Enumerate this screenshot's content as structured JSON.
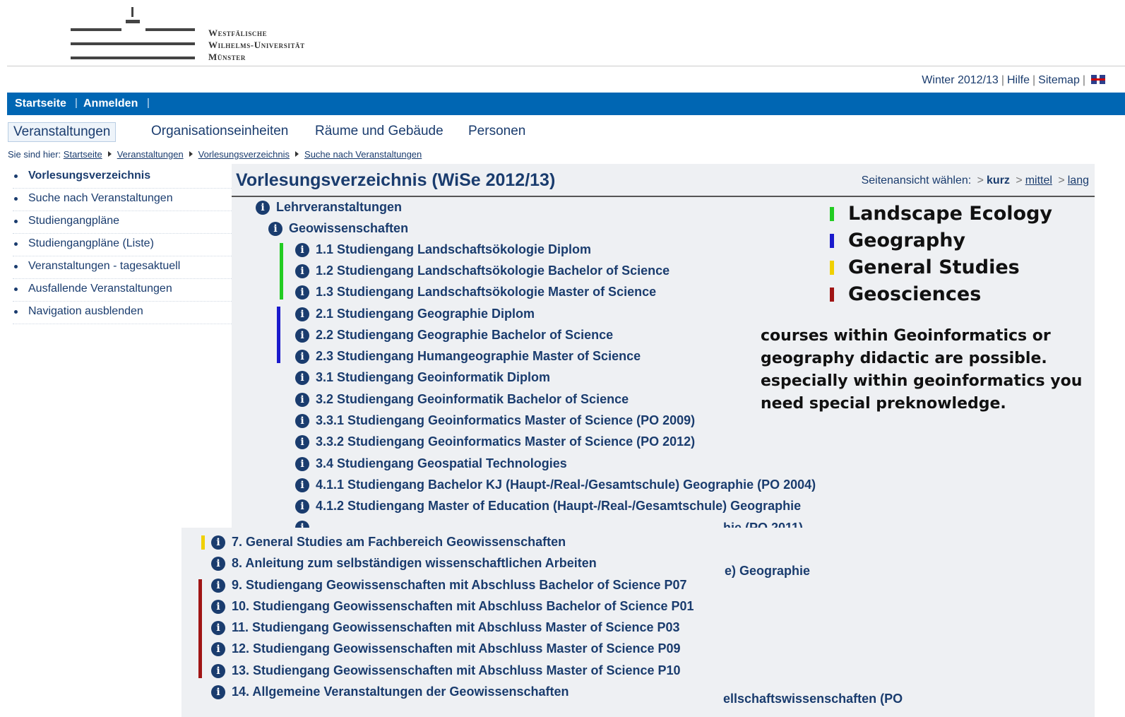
{
  "brand": {
    "logo_lines": [
      "Westfälische",
      "Wilhelms-Universität",
      "Münster"
    ]
  },
  "meta_links": {
    "semester": "Winter 2012/13",
    "help": "Hilfe",
    "sitemap": "Sitemap"
  },
  "topbar": {
    "home": "Startseite",
    "login": "Anmelden"
  },
  "tabs": [
    "Veranstaltungen",
    "Organisationseinheiten",
    "Räume und Gebäude",
    "Personen"
  ],
  "breadcrumb": {
    "prefix": "Sie sind hier:",
    "items": [
      "Startseite",
      "Veranstaltungen",
      "Vorlesungsverzeichnis",
      "Suche nach Veranstaltungen"
    ]
  },
  "sidebar": {
    "items": [
      "Vorlesungsverzeichnis",
      "Suche nach Veranstaltungen",
      "Studiengangpläne",
      "Studiengangpläne (Liste)",
      "Veranstaltungen - tagesaktuell",
      "Ausfallende Veranstaltungen",
      "Navigation ausblenden"
    ]
  },
  "main": {
    "title": "Vorlesungsverzeichnis (WiSe 2012/13)",
    "view_label": "Seitenansicht wählen:",
    "view_options": [
      "kurz",
      "mittel",
      "lang"
    ],
    "tree": [
      "Lehrveranstaltungen",
      "Geowissenschaften",
      "1.1 Studiengang Landschaftsökologie Diplom",
      "1.2 Studiengang Landschaftsökologie Bachelor of Science",
      "1.3 Studiengang Landschaftsökologie Master of Science",
      "2.1 Studiengang Geographie Diplom",
      "2.2 Studiengang Geographie Bachelor of Science",
      "2.3 Studiengang Humangeographie Master of Science",
      "3.1 Studiengang Geoinformatik Diplom",
      "3.2 Studiengang Geoinformatik Bachelor of Science",
      "3.3.1 Studiengang Geoinformatics Master of Science (PO 2009)",
      "3.3.2 Studiengang Geoinformatics Master of Science (PO 2012)",
      "3.4 Studiengang Geospatial Technologies",
      "4.1.1 Studiengang Bachelor KJ (Haupt-/Real-/Gesamtschule) Geographie (PO 2004)",
      "4.1.2 Studiengang Master of Education (Haupt-/Real-/Gesamtschule) Geographie",
      "hie (PO 2011)"
    ],
    "overlay_rows": [
      "7. General Studies am Fachbereich Geowissenschaften",
      "8. Anleitung zum selbständigen wissenschaftlichen Arbeiten",
      "9. Studiengang Geowissenschaften mit Abschluss Bachelor of Science P07",
      "10. Studiengang Geowissenschaften mit Abschluss Bachelor of Science P01",
      "11. Studiengang Geowissenschaften mit Abschluss Master of Science P03",
      "12. Studiengang Geowissenschaften mit Abschluss Master of Science P09",
      "13. Studiengang Geowissenschaften mit Abschluss Master of Science P10",
      "14. Allgemeine Veranstaltungen der Geowissenschaften"
    ],
    "fragments": [
      "e) Geographie",
      "ellschaftswissenschaften (PO"
    ]
  },
  "legend": {
    "items": [
      {
        "label": "Landscape Ecology",
        "color": "#22cc22"
      },
      {
        "label": "Geography",
        "color": "#1a1acc"
      },
      {
        "label": "General Studies",
        "color": "#f0d000"
      },
      {
        "label": "Geosciences",
        "color": "#a01515"
      }
    ],
    "note": "courses within Geoinformatics or geography didactic are possible. especially within geoinformatics you need special preknowledge."
  },
  "colors": {
    "brand_blue": "#0066b3",
    "text_navy": "#1a3c6e",
    "landscape_green": "#22cc22",
    "geography_blue": "#1a1acc",
    "general_yellow": "#f0d000",
    "geosciences_red": "#a01515"
  },
  "icons": {
    "info": "info-circle-icon",
    "flag": "uk-flag-icon"
  }
}
